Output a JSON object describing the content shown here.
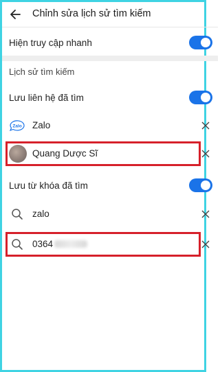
{
  "header": {
    "title": "Chỉnh sửa lịch sử tìm kiếm"
  },
  "quick_access": {
    "label": "Hiện truy cập nhanh",
    "enabled": true
  },
  "history": {
    "section_title": "Lịch sử tìm kiếm",
    "save_contacts": {
      "label": "Lưu liên hệ đã tìm",
      "enabled": true
    },
    "contacts": [
      {
        "name": "Zalo",
        "icon": "zalo-logo-icon"
      },
      {
        "name": "Quang Dược Sĩ",
        "icon": "avatar"
      }
    ],
    "save_keywords": {
      "label": "Lưu từ khóa đã tìm",
      "enabled": true
    },
    "keywords": [
      {
        "text": "zalo"
      },
      {
        "text": "0364"
      }
    ]
  },
  "colors": {
    "accent": "#1a73e8",
    "highlight": "#d6202a",
    "frame": "#3fd3e3"
  }
}
